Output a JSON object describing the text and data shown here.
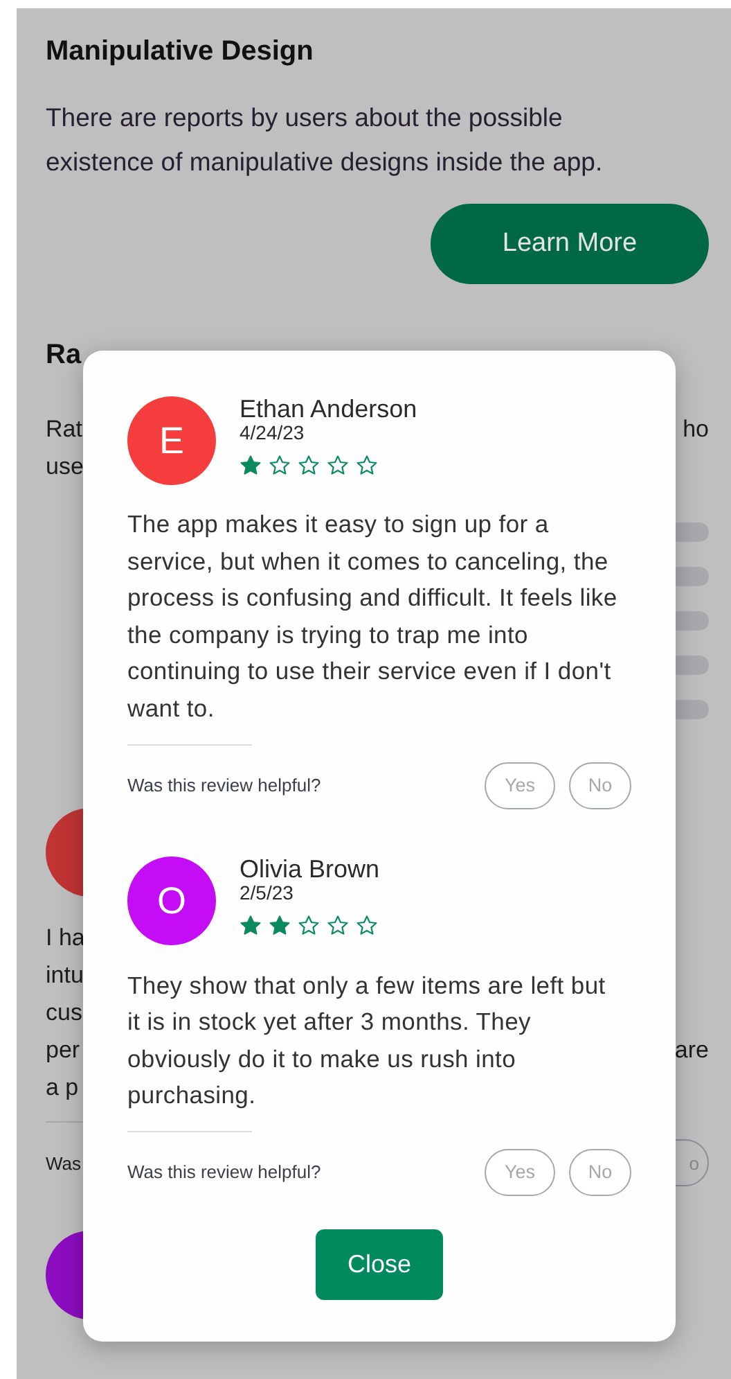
{
  "page": {
    "title": "Manipulative Design",
    "text": "There are reports by users about the possible existence of manipulative designs inside the app.",
    "learn_more": "Learn More"
  },
  "behind": {
    "heading_fragment": "Ra",
    "text_rows": [
      {
        "left": "Rat",
        "right": "ho"
      },
      {
        "left": "use",
        "right": ""
      }
    ],
    "review_rows": [
      {
        "left": "I ha",
        "right": ""
      },
      {
        "left": "intu",
        "right": ""
      },
      {
        "left": "cus",
        "right": ""
      },
      {
        "left": "per",
        "right": "are"
      },
      {
        "left": "a p",
        "right": ""
      }
    ],
    "helpful_fragment": "Was",
    "no_fragment": "o",
    "avatars": [
      {
        "color": "#c13434"
      },
      {
        "color": "#8c0cc0"
      }
    ]
  },
  "modal": {
    "reviews": [
      {
        "initial": "E",
        "color": "#f53d3d",
        "name": "Ethan Anderson",
        "date": "4/24/23",
        "stars": 1,
        "text": "The app makes it easy to sign up for a service, but when it comes to canceling, the process is confusing and difficult. It feels like the company is trying to trap me into continuing to use their service even if I don't want to.",
        "helpful": "Was this review helpful?",
        "yes": "Yes",
        "no": "No"
      },
      {
        "initial": "O",
        "color": "#c40cf5",
        "name": "Olivia Brown",
        "date": "2/5/23",
        "stars": 2,
        "text": "They show that only a few items are left but it is in stock yet after 3 months. They obviously do it to make us rush into purchasing.",
        "helpful": "Was this review helpful?",
        "yes": "Yes",
        "no": "No"
      }
    ],
    "close": "Close"
  }
}
